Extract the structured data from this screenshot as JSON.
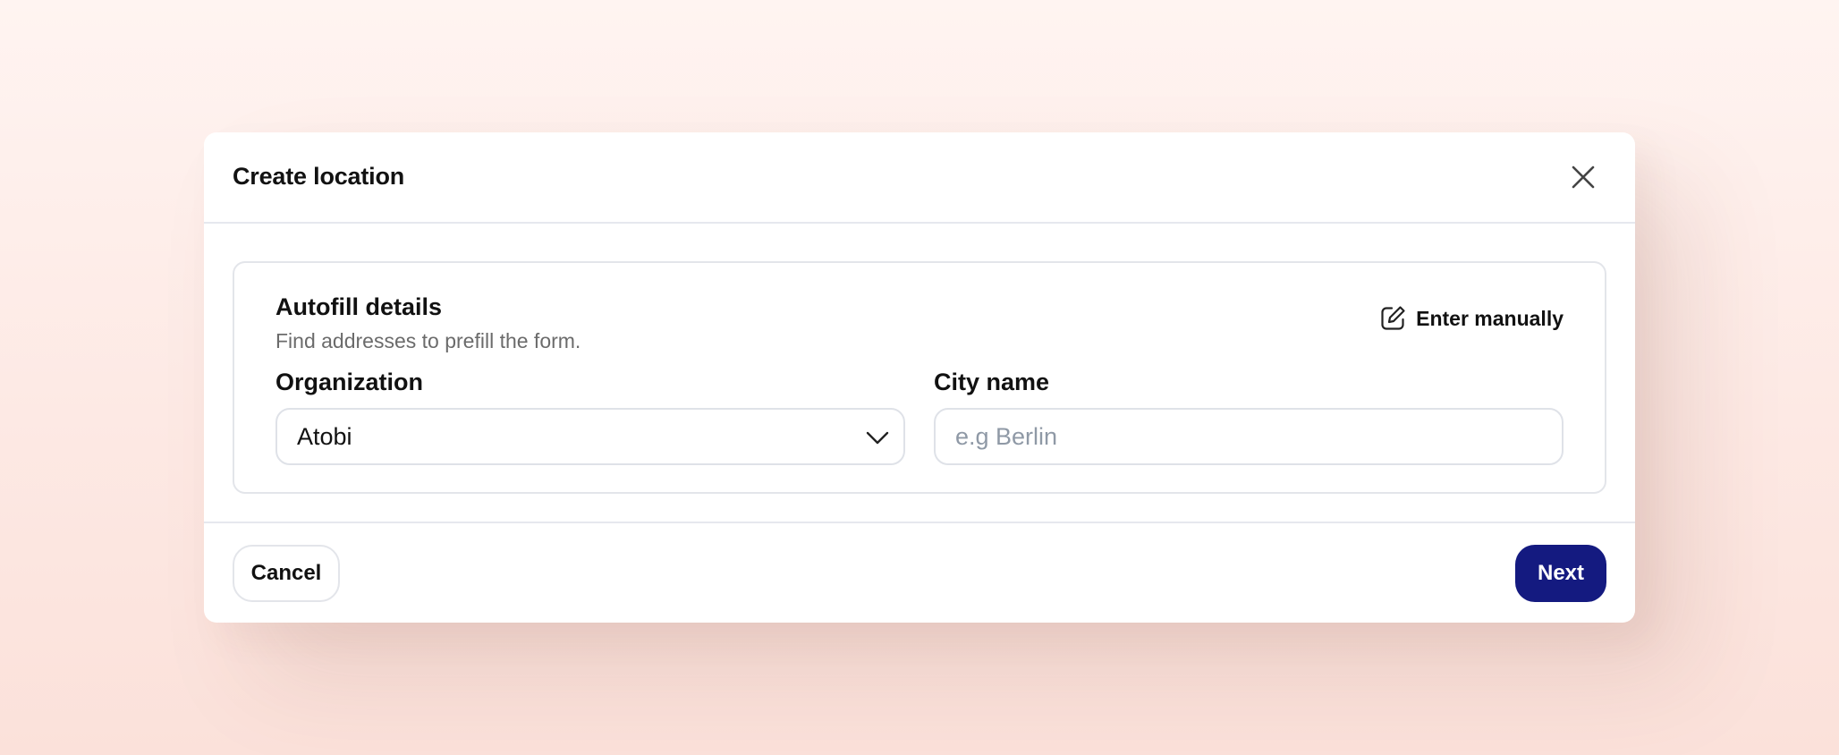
{
  "modal": {
    "title": "Create location"
  },
  "autofill": {
    "title": "Autofill details",
    "subtitle": "Find addresses to prefill the form.",
    "enter_manually_label": "Enter manually"
  },
  "organization": {
    "label": "Organization",
    "selected_value": "Atobi"
  },
  "city": {
    "label": "City name",
    "value": "",
    "placeholder": "e.g Berlin"
  },
  "footer": {
    "cancel_label": "Cancel",
    "next_label": "Next"
  },
  "colors": {
    "primary": "#141a80",
    "border": "#e3e5ea",
    "placeholder": "#8f99a6"
  },
  "icons": {
    "close": "close-icon",
    "edit": "edit-icon",
    "chevron": "chevron-down-icon"
  }
}
